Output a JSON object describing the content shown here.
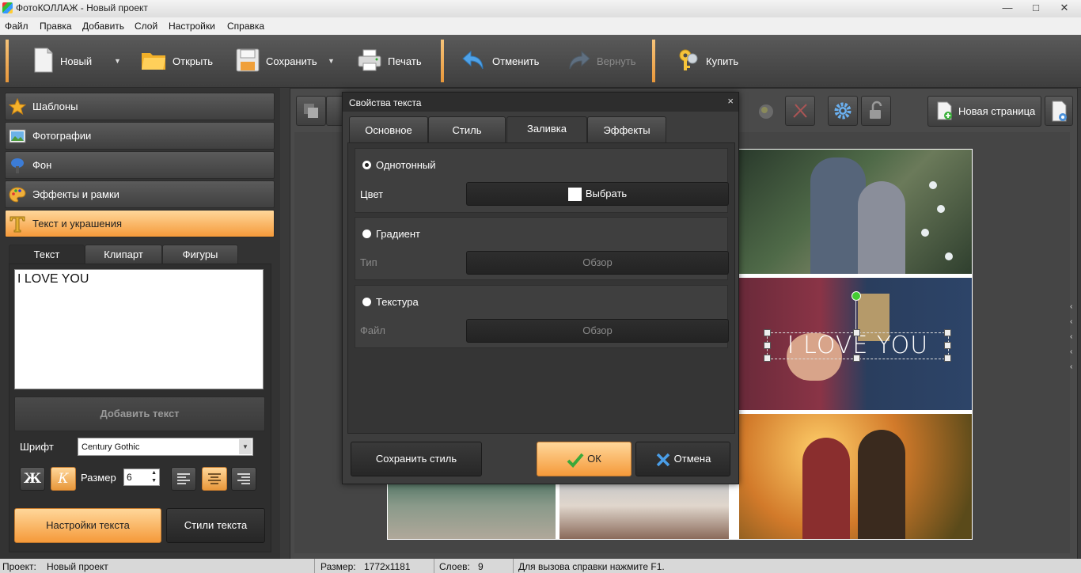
{
  "window": {
    "title": "ФотоКОЛЛАЖ - Новый проект",
    "controls": [
      "—",
      "□",
      "✕"
    ]
  },
  "menu": [
    "Файл",
    "Правка",
    "Добавить",
    "Слой",
    "Настройки",
    "Справка"
  ],
  "toolbar": {
    "new": "Новый",
    "open": "Открыть",
    "save": "Сохранить",
    "print": "Печать",
    "undo": "Отменить",
    "redo": "Вернуть",
    "buy": "Купить"
  },
  "sidebar": {
    "categories": [
      "Шаблоны",
      "Фотографии",
      "Фон",
      "Эффекты и рамки",
      "Текст и украшения"
    ],
    "tabs": [
      "Текст",
      "Клипарт",
      "Фигуры"
    ],
    "text_value": "I LOVE YOU",
    "add_text": "Добавить текст",
    "font_label": "Шрифт",
    "font_value": "Century Gothic",
    "bold_glyph": "Ж",
    "italic_glyph": "К",
    "size_label": "Размер",
    "size_value": "6",
    "settings_button": "Настройки текста",
    "styles_button": "Стили текста"
  },
  "canvas": {
    "new_page": "Новая страница",
    "overlay_text": "I LOVE YOU"
  },
  "dialog": {
    "title": "Свойства текста",
    "close": "×",
    "tabs": [
      "Основное",
      "Стиль",
      "Заливка",
      "Эффекты"
    ],
    "active_tab": "Заливка",
    "solid": {
      "label": "Однотонный",
      "row_label": "Цвет",
      "button": "Выбрать",
      "selected": true
    },
    "gradient": {
      "label": "Градиент",
      "row_label": "Тип",
      "button": "Обзор"
    },
    "texture": {
      "label": "Текстура",
      "row_label": "Файл",
      "button": "Обзор"
    },
    "save_style": "Сохранить стиль",
    "ok": "ОК",
    "cancel": "Отмена"
  },
  "status": {
    "project_label": "Проект:",
    "project_value": "Новый проект",
    "size_label": "Размер:",
    "size_value": "1772x1181",
    "layers_label": "Слоев:",
    "layers_value": "9",
    "help": "Для вызова справки нажмите F1."
  },
  "colors": {
    "accent": "#f5a44a",
    "panel": "#3d3d3d",
    "toolbar": "#4a4a4a"
  }
}
